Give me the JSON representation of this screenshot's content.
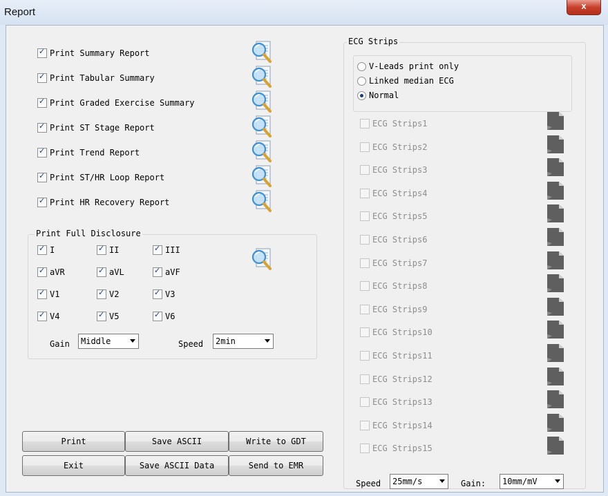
{
  "window": {
    "title": "Report",
    "close_label": "x"
  },
  "print_options": [
    {
      "label": "Print Summary Report",
      "checked": true
    },
    {
      "label": "Print Tabular Summary",
      "checked": true
    },
    {
      "label": "Print Graded Exercise Summary",
      "checked": true
    },
    {
      "label": "Print ST Stage Report",
      "checked": true
    },
    {
      "label": "Print Trend Report",
      "checked": true
    },
    {
      "label": "Print ST/HR Loop Report",
      "checked": true
    },
    {
      "label": "Print HR Recovery Report",
      "checked": true
    }
  ],
  "full_disclosure": {
    "title": "Print Full Disclosure",
    "leads": [
      {
        "label": "I",
        "checked": true
      },
      {
        "label": "II",
        "checked": true
      },
      {
        "label": "III",
        "checked": true
      },
      {
        "label": "aVR",
        "checked": true
      },
      {
        "label": "aVL",
        "checked": true
      },
      {
        "label": "aVF",
        "checked": true
      },
      {
        "label": "V1",
        "checked": true
      },
      {
        "label": "V2",
        "checked": true
      },
      {
        "label": "V3",
        "checked": true
      },
      {
        "label": "V4",
        "checked": true
      },
      {
        "label": "V5",
        "checked": true
      },
      {
        "label": "V6",
        "checked": true
      }
    ],
    "gain_label": "Gain",
    "gain_value": "Middle",
    "speed_label": "Speed",
    "speed_value": "2min"
  },
  "ecg_strips": {
    "title": "ECG Strips",
    "modes": [
      {
        "label": "V-Leads print only",
        "selected": false
      },
      {
        "label": "Linked median ECG",
        "selected": false
      },
      {
        "label": "Normal",
        "selected": true
      }
    ],
    "strips": [
      "ECG Strips1",
      "ECG Strips2",
      "ECG Strips3",
      "ECG Strips4",
      "ECG Strips5",
      "ECG Strips6",
      "ECG Strips7",
      "ECG Strips8",
      "ECG Strips9",
      "ECG Strips10",
      "ECG Strips11",
      "ECG Strips12",
      "ECG Strips13",
      "ECG Strips14",
      "ECG Strips15"
    ],
    "speed_label": "Speed",
    "speed_value": "25mm/s",
    "gain_label": "Gain:",
    "gain_value": "10mm/mV"
  },
  "buttons": {
    "print": "Print",
    "save_ascii": "Save ASCII",
    "write_gdt": "Write to GDT",
    "exit": "Exit",
    "save_ascii_data": "Save ASCII Data",
    "send_emr": "Send to EMR"
  },
  "icons": {
    "preview": "magnifier-document-icon",
    "strip": "ecg-paper-strip-icon"
  },
  "colors": {
    "title_bar": "#dfe9f5",
    "close_button": "#c8402c",
    "client_background": "#f0f0f0",
    "check_mark": "#1b3c73",
    "disabled_text": "#8d8d8d"
  }
}
